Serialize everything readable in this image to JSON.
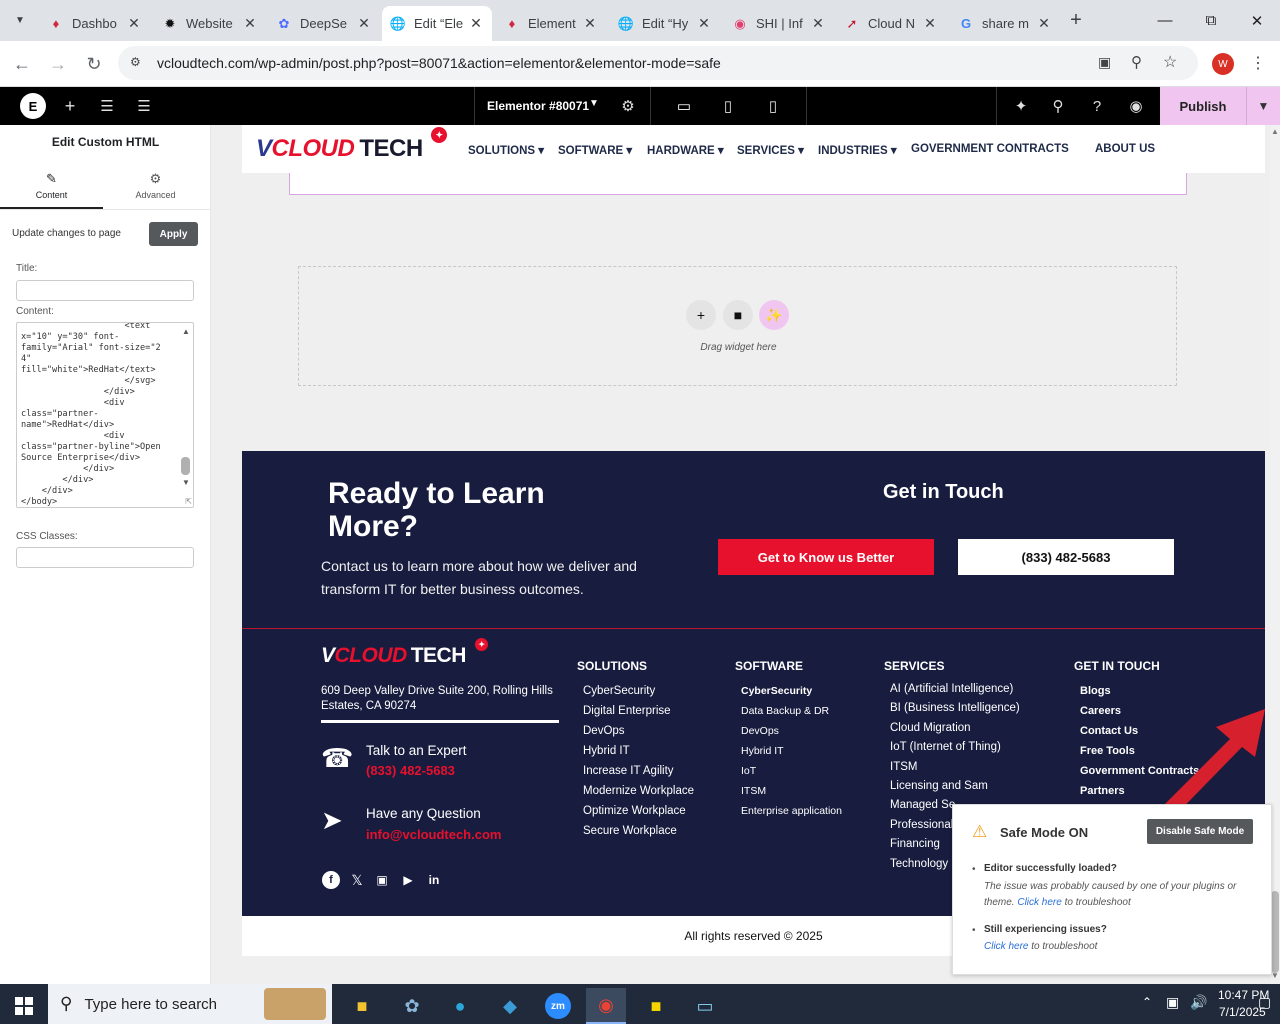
{
  "browser": {
    "tabs": [
      {
        "title": "Dashbo",
        "icon": "elementor-red-icon"
      },
      {
        "title": "Website",
        "icon": "openai-icon"
      },
      {
        "title": "DeepSe",
        "icon": "deepseek-icon"
      },
      {
        "title": "Edit “Ele",
        "icon": "globe-icon",
        "active": true
      },
      {
        "title": "Element",
        "icon": "elementor-red-icon"
      },
      {
        "title": "Edit “Hy",
        "icon": "globe-icon"
      },
      {
        "title": "SHI | Inf",
        "icon": "shi-icon"
      },
      {
        "title": "Cloud N",
        "icon": "cloud-icon"
      },
      {
        "title": "share m",
        "icon": "google-icon"
      }
    ],
    "url": "vcloudtech.com/wp-admin/post.php?post=80071&action=elementor&elementor-mode=safe",
    "profile_initial": "W"
  },
  "editor": {
    "document_title": "Elementor #80071",
    "publish_label": "Publish"
  },
  "panel": {
    "title": "Edit Custom HTML",
    "tabs": [
      "Content",
      "Advanced"
    ],
    "update_text": "Update changes to page",
    "apply_label": "Apply",
    "title_label": "Title:",
    "content_label": "Content:",
    "css_label": "CSS Classes:",
    "code": "                    <text\nx=\"10\" y=\"30\" font-\nfamily=\"Arial\" font-size=\"24\"\nfill=\"white\">RedHat</text>\n                    </svg>\n                </div>\n                <div\nclass=\"partner-\nname\">RedHat</div>\n                <div\nclass=\"partner-byline\">Open\nSource Enterprise</div>\n            </div>\n        </div>\n    </div>\n</body>\n</html>"
  },
  "site": {
    "logo": {
      "v": "V",
      "cloud": "CLOUD",
      "tech": "TECH"
    },
    "nav": [
      "SOLUTIONS",
      "SOFTWARE",
      "HARDWARE",
      "SERVICES",
      "INDUSTRIES",
      "GOVERNMENT CONTRACTS",
      "ABOUT US"
    ],
    "dropzone_text": "Drag widget here",
    "cta": {
      "heading": "Ready to Learn More?",
      "text": "Contact us to learn more about how we deliver and transform IT for better business outcomes.",
      "get_in_touch": "Get in Touch",
      "btn_primary": "Get to Know us Better",
      "btn_phone": "(833) 482-5683"
    },
    "footer": {
      "address": "609 Deep Valley Drive Suite 200, Rolling Hills Estates, CA 90274",
      "expert_label": "Talk to an Expert",
      "expert_phone": "(833) 482-5683",
      "question_label": "Have any Question",
      "email": "info@vcloudtech.com",
      "columns": [
        {
          "title": "SOLUTIONS",
          "items": [
            "CyberSecurity",
            "Digital Enterprise",
            "DevOps",
            "Hybrid IT",
            "Increase IT Agility",
            "Modernize Workplace",
            "Optimize Workplace",
            "Secure Workplace"
          ]
        },
        {
          "title": "SOFTWARE",
          "items": [
            "CyberSecurity",
            "Data Backup & DR",
            "DevOps",
            "Hybrid IT",
            "IoT",
            "ITSM",
            "Enterprise application"
          ]
        },
        {
          "title": "SERVICES",
          "items": [
            "AI (Artificial Intelligence)",
            "BI (Business Intelligence)",
            "Cloud Migration",
            "IoT (Internet of Thing)",
            "ITSM",
            "Licensing and Sam",
            "Managed Se",
            "Professional",
            "Financing",
            "Technology"
          ]
        },
        {
          "title": "GET IN TOUCH",
          "items": [
            "Blogs",
            "Careers",
            "Contact Us",
            "Free Tools",
            "Government Contracts",
            "Partners"
          ]
        }
      ],
      "copyright": "All rights reserved © 2025"
    }
  },
  "safe_mode": {
    "title": "Safe Mode ON",
    "disable_label": "Disable Safe Mode",
    "q1": "Editor successfully loaded?",
    "a1_text": "The issue was probably caused by one of your plugins or theme.",
    "a1_link": "Click here",
    "a1_tail": "to troubleshoot",
    "q2": "Still experiencing issues?",
    "a2_link": "Click here",
    "a2_tail": "to troubleshoot"
  },
  "taskbar": {
    "search_placeholder": "Type here to search",
    "time": "10:47 PM",
    "date": "7/1/2025"
  },
  "colors": {
    "accent_red": "#e8112d",
    "footer_navy": "#181c3e",
    "publish_pink": "#f0c6f0"
  }
}
